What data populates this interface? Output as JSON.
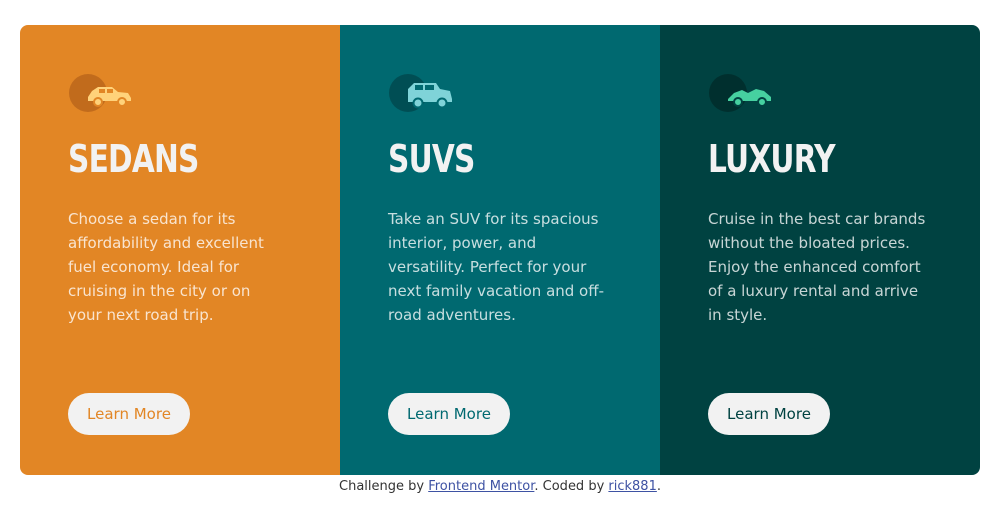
{
  "cards": [
    {
      "icon": "sedan-car-icon",
      "title": "SEDANS",
      "description": "Choose a sedan for its affordability and excellent fuel economy. Ideal for cruising in the city or on your next road trip.",
      "button_label": "Learn More",
      "color": "#e28625"
    },
    {
      "icon": "suv-car-icon",
      "title": "SUVS",
      "description": "Take an SUV for its spacious interior, power, and versatility. Perfect for your next family vacation and off-road adventures.",
      "button_label": "Learn More",
      "color": "#006970"
    },
    {
      "icon": "luxury-car-icon",
      "title": "LUXURY",
      "description": "Cruise in the best car brands without the bloated prices. Enjoy the enhanced comfort of a luxury rental and arrive in style.",
      "button_label": "Learn More",
      "color": "#004241"
    }
  ],
  "attribution": {
    "prefix": "Challenge by ",
    "link1": "Frontend Mentor",
    "middle": ". Coded by ",
    "link2": "rick881",
    "suffix": "."
  }
}
